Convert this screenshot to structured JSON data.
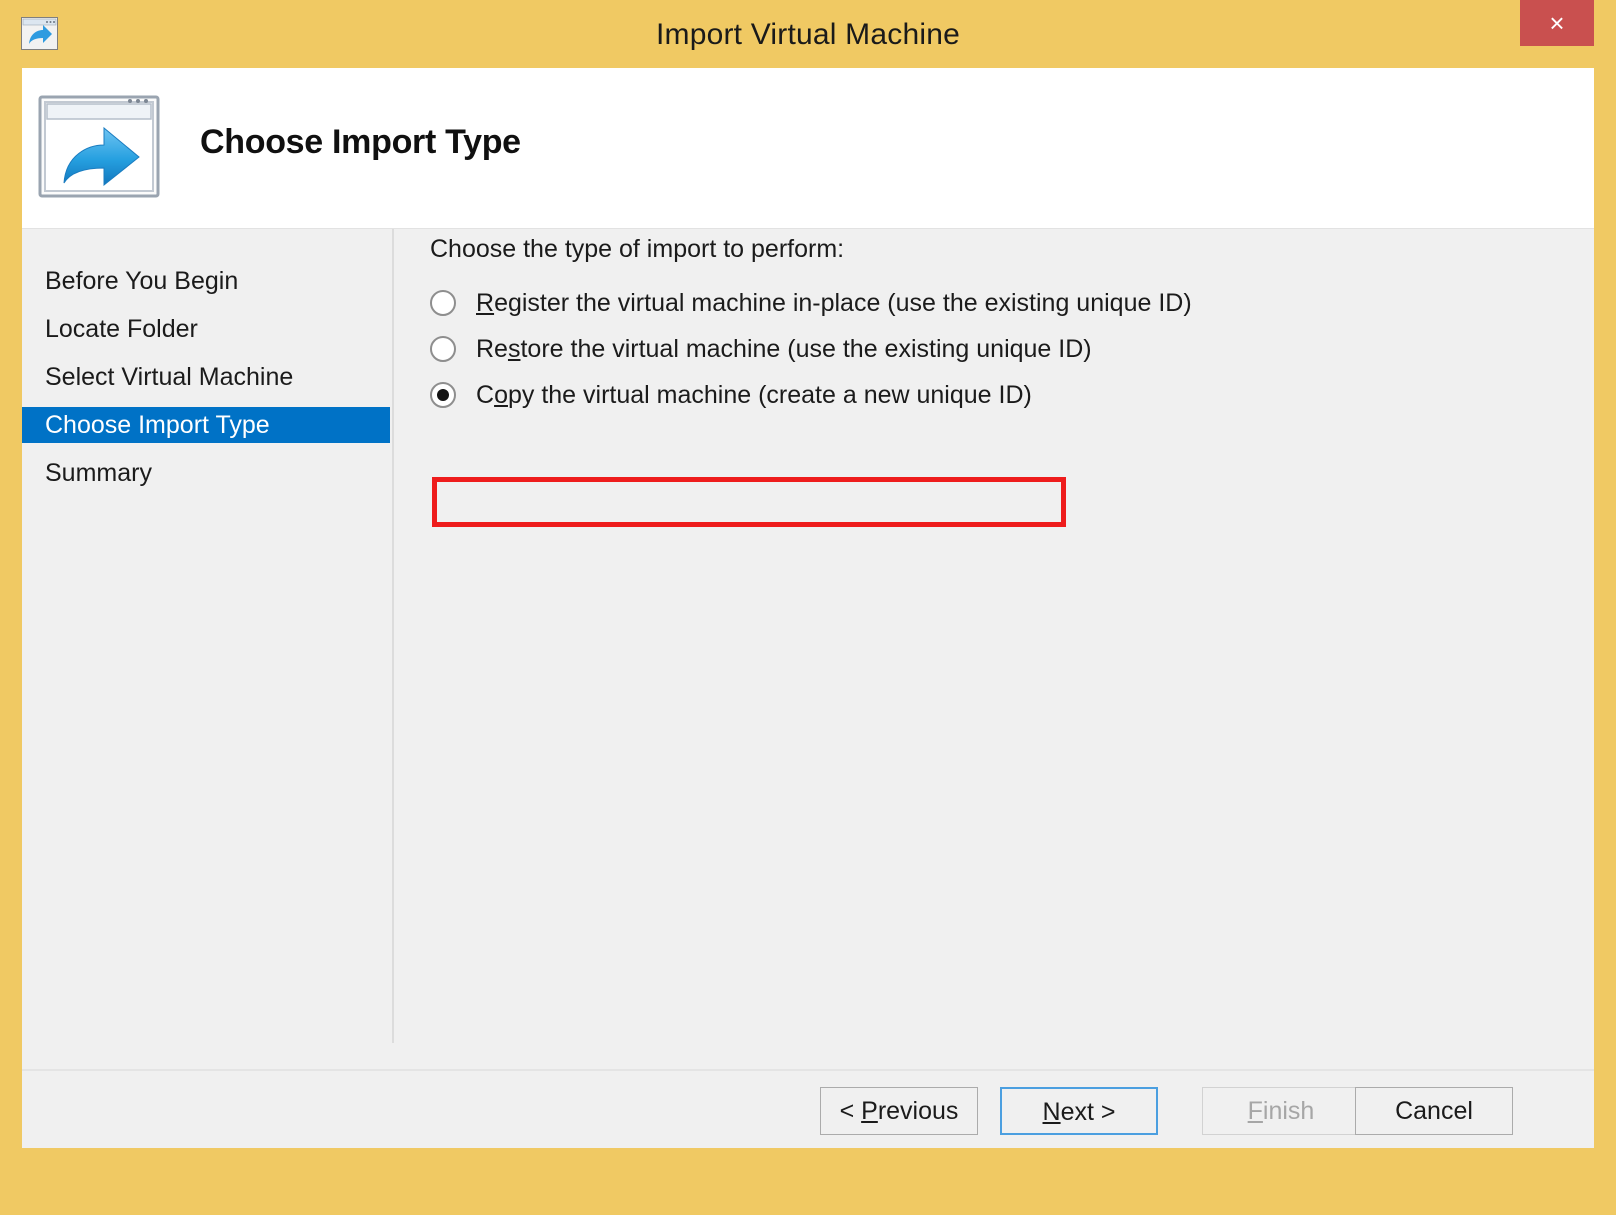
{
  "window": {
    "title": "Import Virtual Machine",
    "title_icon": "import-vm-icon",
    "close_label": "×",
    "accent_titlebar_color": "#F0C963",
    "close_button_color": "#C9504F"
  },
  "header": {
    "icon": "import-vm-large-icon",
    "title": "Choose Import Type"
  },
  "sidebar": {
    "selected_color": "#0072C6",
    "items": [
      {
        "label": "Before You Begin",
        "selected": false
      },
      {
        "label": "Locate Folder",
        "selected": false
      },
      {
        "label": "Select Virtual Machine",
        "selected": false
      },
      {
        "label": "Choose Import Type",
        "selected": true
      },
      {
        "label": "Summary",
        "selected": false
      }
    ]
  },
  "main": {
    "prompt": "Choose the type of import to perform:",
    "highlight_color": "#EE1C1C",
    "options": [
      {
        "id": "register-in-place",
        "accel_prefix": "",
        "accel_char": "R",
        "label_rest": "egister the virtual machine in-place (use the existing unique ID)",
        "full_label": "Register the virtual machine in-place (use the existing unique ID)",
        "checked": false
      },
      {
        "id": "restore",
        "accel_prefix": "Re",
        "accel_char": "s",
        "label_rest": "tore the virtual machine (use the existing unique ID)",
        "full_label": "Restore the virtual machine (use the existing unique ID)",
        "checked": false
      },
      {
        "id": "copy-new-id",
        "accel_prefix": "C",
        "accel_char": "o",
        "label_rest": "py the virtual machine (create a new unique ID)",
        "full_label": "Copy the virtual machine (create a new unique ID)",
        "checked": true,
        "highlighted": true
      }
    ]
  },
  "footer": {
    "buttons": [
      {
        "id": "previous",
        "prefix": "< ",
        "accel_char": "P",
        "suffix": "revious",
        "full_label": "< Previous",
        "state": "enabled"
      },
      {
        "id": "next",
        "prefix": "",
        "accel_char": "N",
        "suffix": "ext >",
        "full_label": "Next >",
        "state": "focused"
      },
      {
        "id": "finish",
        "prefix": "",
        "accel_char": "F",
        "suffix": "inish",
        "full_label": "Finish",
        "state": "disabled"
      },
      {
        "id": "cancel",
        "prefix": "",
        "accel_char": "",
        "suffix": "Cancel",
        "full_label": "Cancel",
        "state": "enabled"
      }
    ]
  }
}
